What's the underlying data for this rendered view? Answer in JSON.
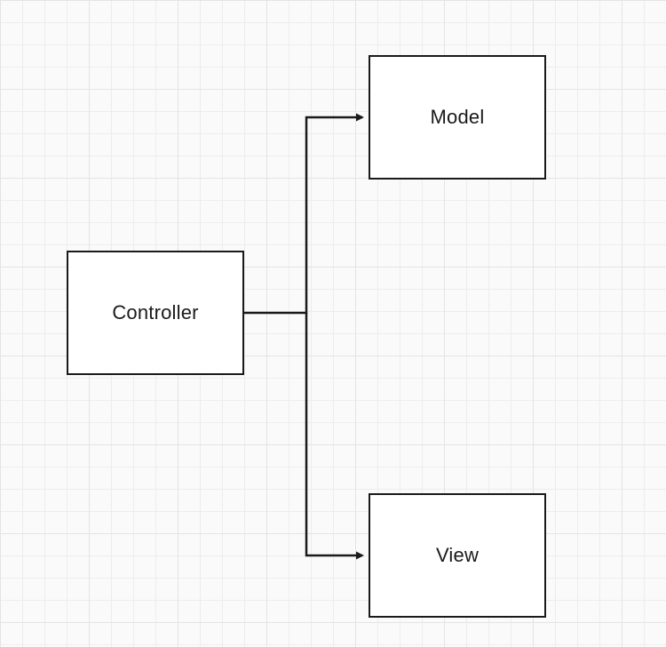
{
  "diagram": {
    "nodes": {
      "controller": {
        "label": "Controller"
      },
      "model": {
        "label": "Model"
      },
      "view": {
        "label": "View"
      }
    },
    "edges": [
      {
        "from": "controller",
        "to": "model",
        "style": "orthogonal-arrow"
      },
      {
        "from": "controller",
        "to": "view",
        "style": "orthogonal-arrow"
      }
    ]
  }
}
